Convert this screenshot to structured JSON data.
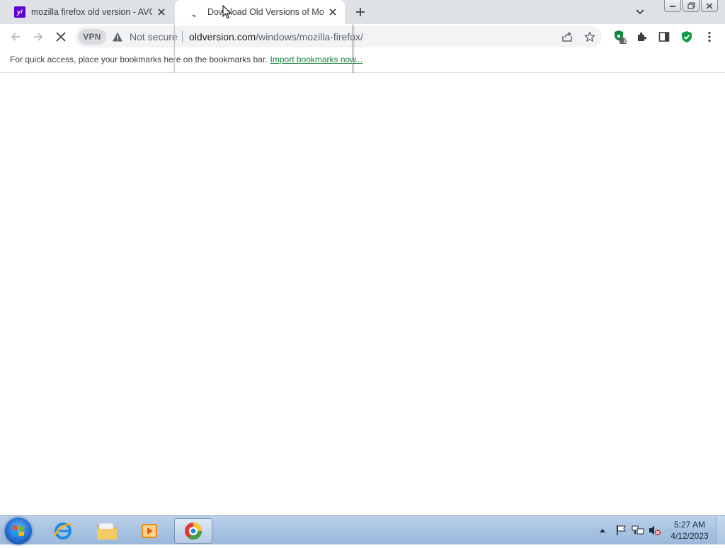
{
  "tabs": [
    {
      "title": "mozilla firefox old version - AVG",
      "favicon": "yahoo-favicon",
      "active": false
    },
    {
      "title": "Download Old Versions of Mozilla",
      "favicon": "loading-spinner",
      "active": true
    }
  ],
  "toolbar": {
    "vpn_label": "VPN",
    "security_label": "Not secure",
    "url_host": "oldversion.com",
    "url_path": "/windows/mozilla-firefox/",
    "extension_badge": "2"
  },
  "bookmarks_bar": {
    "message": "For quick access, place your bookmarks here on the bookmarks bar.",
    "import_link": "Import bookmarks now..."
  },
  "taskbar": {
    "clock_time": "5:27 AM",
    "clock_date": "4/12/2023"
  },
  "colors": {
    "accent_green": "#188038",
    "yahoo_purple": "#6001d2",
    "taskbar_blue": "#a9c4e2"
  }
}
